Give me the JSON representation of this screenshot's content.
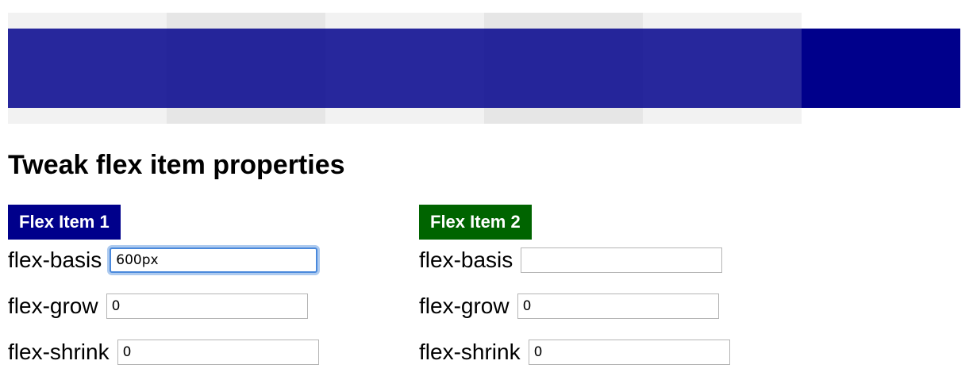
{
  "demo": {
    "track_cells": 5,
    "bar_color": "#00008b"
  },
  "heading": "Tweak flex item properties",
  "panels": [
    {
      "title": "Flex Item 1",
      "color": "#00008b",
      "fields": {
        "flex_basis": {
          "label": "flex-basis",
          "value": "600px"
        },
        "flex_grow": {
          "label": "flex-grow",
          "value": "0"
        },
        "flex_shrink": {
          "label": "flex-shrink",
          "value": "0"
        }
      }
    },
    {
      "title": "Flex Item 2",
      "color": "#006400",
      "fields": {
        "flex_basis": {
          "label": "flex-basis",
          "value": ""
        },
        "flex_grow": {
          "label": "flex-grow",
          "value": "0"
        },
        "flex_shrink": {
          "label": "flex-shrink",
          "value": "0"
        }
      }
    }
  ]
}
